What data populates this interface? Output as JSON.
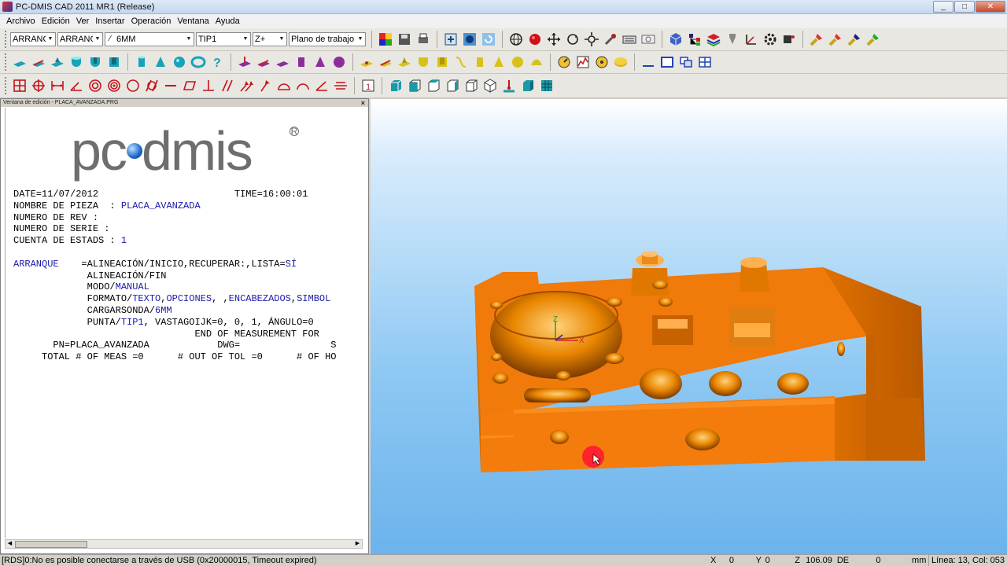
{
  "window": {
    "title": "PC-DMIS CAD 2011 MR1 (Release)",
    "min": "_",
    "max": "□",
    "close": "✕"
  },
  "menu": [
    "Archivo",
    "Edición",
    "Ver",
    "Insertar",
    "Operación",
    "Ventana",
    "Ayuda"
  ],
  "combos": {
    "alignment": "ARRANC",
    "coordsys": "ARRANC",
    "probe": "6MM",
    "tip": "TIP1",
    "axis": "Z+",
    "workplane": "Plano de trabajo"
  },
  "edit_window": {
    "title": "Ventana de edición - PLACA_AVANZADA.PRG",
    "logo": {
      "left": "pc",
      "right": "dmis",
      "reg": "R"
    },
    "lines": [
      [
        {
          "t": "DATE=11/07/2012                        TIME=16:00:01"
        }
      ],
      [
        {
          "t": "NOMBRE DE PIEZA  : "
        },
        {
          "t": "PLACA_AVANZADA",
          "k": 1
        }
      ],
      [
        {
          "t": "NUMERO DE REV : "
        }
      ],
      [
        {
          "t": "NUMERO DE SERIE : "
        }
      ],
      [
        {
          "t": "CUENTA DE ESTADS : "
        },
        {
          "t": "1",
          "k": 1
        }
      ],
      [
        {
          "t": ""
        }
      ],
      [
        {
          "t": "ARRANQUE",
          "k": 1
        },
        {
          "t": "    =ALINEACIÓN/INICIO,RECUPERAR:,LISTA="
        },
        {
          "t": "SÍ",
          "k": 1
        }
      ],
      [
        {
          "t": "             ALINEACIÓN/FIN"
        }
      ],
      [
        {
          "t": "             MODO/"
        },
        {
          "t": "MANUAL",
          "k": 1
        }
      ],
      [
        {
          "t": "             FORMATO/"
        },
        {
          "t": "TEXTO",
          "k": 1
        },
        {
          "t": ","
        },
        {
          "t": "OPCIONES",
          "k": 1
        },
        {
          "t": ", ,"
        },
        {
          "t": "ENCABEZADOS",
          "k": 1
        },
        {
          "t": ","
        },
        {
          "t": "SIMBOL",
          "k": 1
        }
      ],
      [
        {
          "t": "             CARGARSONDA/"
        },
        {
          "t": "6MM",
          "k": 1
        }
      ],
      [
        {
          "t": "             PUNTA/"
        },
        {
          "t": "TIP1",
          "k": 1
        },
        {
          "t": ", VASTAGOIJK=0, 0, 1, ÁNGULO=0"
        }
      ],
      [
        {
          "t": "                                END OF MEASUREMENT FOR"
        }
      ],
      [
        {
          "t": "       PN=PLACA_AVANZADA            DWG=                S"
        }
      ],
      [
        {
          "t": "     TOTAL # OF MEAS =0      # OUT OF TOL =0      # OF HO"
        }
      ]
    ]
  },
  "triad": {
    "x": "X",
    "z": "Z"
  },
  "status": {
    "message": "[RDS]0:No es posible conectarse a través de USB (0x20000015, Timeout expired)",
    "x_label": "X",
    "x_val": "0",
    "y_label": "Y",
    "y_val": "0",
    "z_label": "Z",
    "z_val": "106.09",
    "de": "DE",
    "de_val": "0",
    "units": "mm",
    "line_col": "Línea: 13, Col: 053"
  },
  "colors": {
    "part": "#f37c0d",
    "part_dark": "#c35c00",
    "viewport_top": "#ffffff",
    "viewport_bottom": "#6cb3ec",
    "code_keyword": "#1a1aa8"
  }
}
